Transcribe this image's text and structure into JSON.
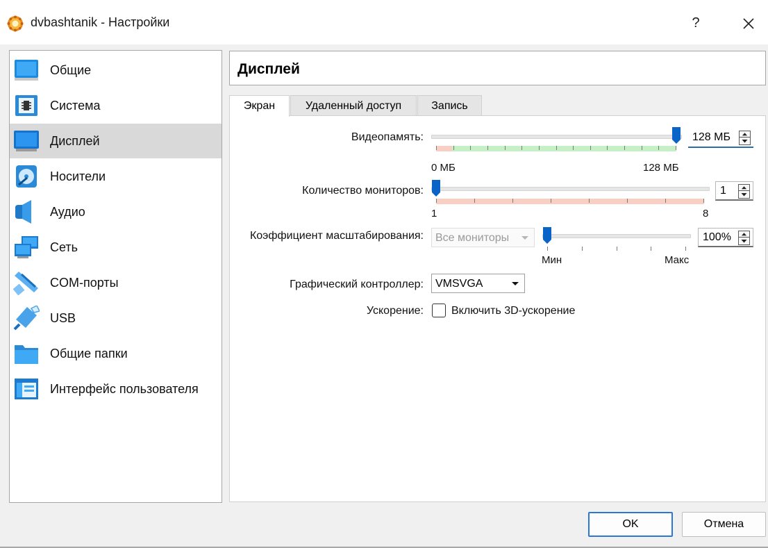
{
  "window": {
    "title": "dvbashtanik - Настройки",
    "help_label": "?"
  },
  "sidebar": {
    "items": [
      {
        "label": "Общие",
        "icon": "general-monitor-icon"
      },
      {
        "label": "Система",
        "icon": "chip-icon"
      },
      {
        "label": "Дисплей",
        "icon": "display-monitor-icon",
        "selected": true
      },
      {
        "label": "Носители",
        "icon": "storage-disc-icon"
      },
      {
        "label": "Аудио",
        "icon": "speaker-icon"
      },
      {
        "label": "Сеть",
        "icon": "network-icon"
      },
      {
        "label": "COM-порты",
        "icon": "serial-port-icon"
      },
      {
        "label": "USB",
        "icon": "usb-icon"
      },
      {
        "label": "Общие папки",
        "icon": "folder-icon"
      },
      {
        "label": "Интерфейс пользователя",
        "icon": "user-interface-icon"
      }
    ]
  },
  "header": {
    "title": "Дисплей"
  },
  "tabs": [
    {
      "label": "Экран",
      "active": true
    },
    {
      "label": "Удаленный доступ"
    },
    {
      "label": "Запись"
    }
  ],
  "screen": {
    "video_memory": {
      "label": "Видеопамять:",
      "value": "128 МБ",
      "min_label": "0 МБ",
      "max_label": "128 МБ",
      "fraction": 1.0
    },
    "monitors": {
      "label": "Количество мониторов:",
      "value": "1",
      "min_label": "1",
      "max_label": "8",
      "fraction": 0.0
    },
    "scale": {
      "label": "Коэффициент масштабирования:",
      "combo_value": "Все мониторы",
      "value": "100%",
      "min_label": "Мин",
      "max_label": "Макс",
      "fraction": 0.0
    },
    "controller": {
      "label": "Графический контроллер:",
      "value": "VMSVGA"
    },
    "acceleration": {
      "label": "Ускорение:",
      "checkbox_label": "Включить 3D-ускорение",
      "checked": false
    }
  },
  "buttons": {
    "ok": "OK",
    "cancel": "Отмена"
  },
  "colors": {
    "accent": "#0a64c8",
    "selection": "#d9d9d9",
    "zone_ok": "#c6efc6",
    "zone_bad": "#f8cfc3"
  }
}
